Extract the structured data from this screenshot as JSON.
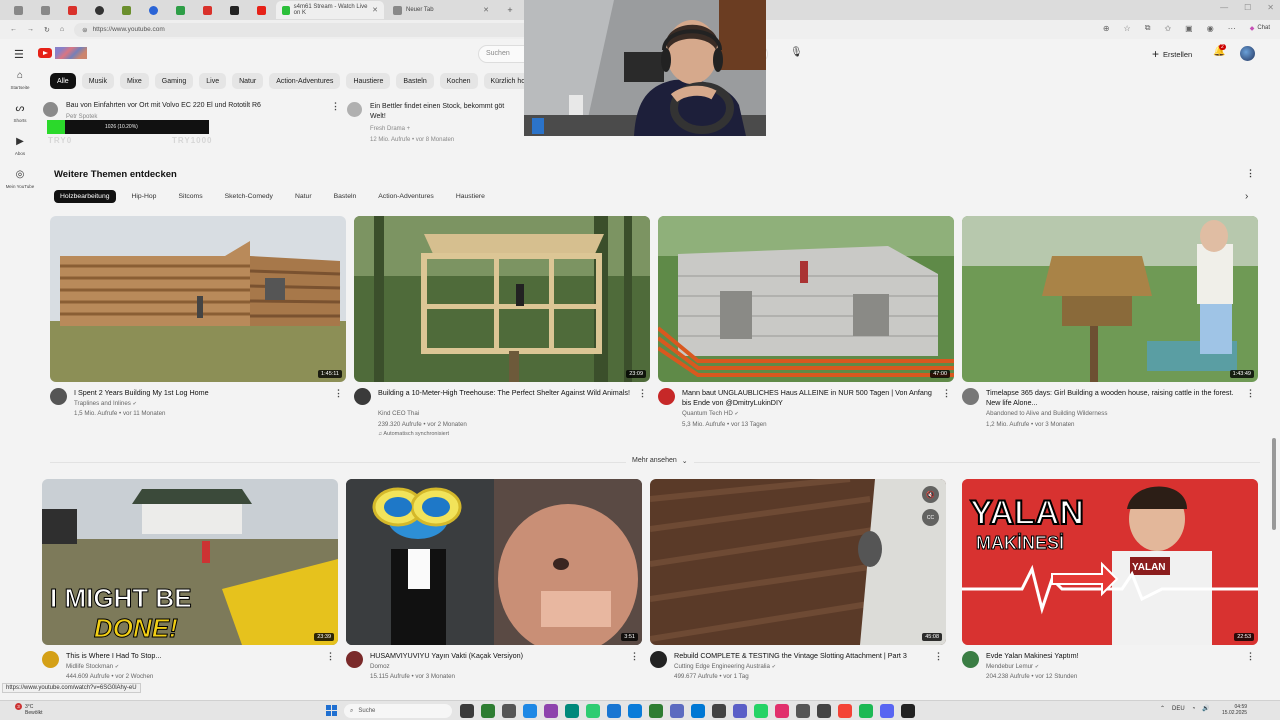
{
  "browser": {
    "tabs": [
      {
        "label": "s4m61 Stream - Watch Live on K",
        "color": "#2bbf3a"
      },
      {
        "label": "Neuer Tab",
        "color": "#888888"
      }
    ],
    "pinned_tab_colors": [
      "#888888",
      "#888888",
      "#d9312b",
      "#333333",
      "#6b8f2d",
      "#2a64d6",
      "#2e9e47",
      "#d9312b",
      "#222222",
      "#e62117"
    ],
    "url": "https://www.youtube.com",
    "chat_label": "Chat"
  },
  "header": {
    "search_placeholder": "Suchen",
    "create_label": "Erstellen",
    "notification_count": "2"
  },
  "sidebar": {
    "items": [
      {
        "label": "Startseite",
        "icon": "home-icon"
      },
      {
        "label": "Shorts",
        "icon": "shorts-icon"
      },
      {
        "label": "Abos",
        "icon": "subscriptions-icon"
      },
      {
        "label": "Mein YouTube",
        "icon": "you-icon"
      }
    ]
  },
  "chips": [
    "Alle",
    "Musik",
    "Mixe",
    "Gaming",
    "Live",
    "Natur",
    "Action-Adventures",
    "Haustiere",
    "Basteln",
    "Kochen",
    "Kürzlich hochgel"
  ],
  "prev_row": {
    "left": {
      "title": "Bau von Einfahrten vor Ort mit Volvo EC 220 El und Rototilt R6",
      "channel": "Petr Spotek",
      "gamebar_text": "1026 (10.20%)",
      "ghost_a": "TRY0",
      "ghost_b": "TRY1000"
    },
    "right": {
      "title_line1": "Ein Bettler findet einen Stock, bekommt göt",
      "title_line2": "Welt!",
      "channel": "Fresh Drama +",
      "meta": "12 Mio. Aufrufe • vor 8 Monaten"
    }
  },
  "topics": {
    "title": "Weitere Themen entdecken",
    "chips": [
      "Holzbearbeitung",
      "Hip-Hop",
      "Sitcoms",
      "Sketch-Comedy",
      "Natur",
      "Basteln",
      "Action-Adventures",
      "Haustiere"
    ]
  },
  "row1": [
    {
      "title": "I Spent 2 Years Building My 1st Log Home",
      "channel": "Traplines and Inlines",
      "meta": "1,5 Mio. Aufrufe • vor 11 Monaten",
      "duration": "1:45:11",
      "avatar": "#555555"
    },
    {
      "title": "Building a 10-Meter-High Treehouse: The Perfect Shelter Against Wild Animals!",
      "channel": "Kind CEO Thai",
      "meta": "239.320 Aufrufe • vor 2 Monaten",
      "duration": "23:09",
      "avatar": "#3a3a3a",
      "extra": "Automatisch synchronisiert"
    },
    {
      "title": "Mann baut UNGLAUBLICHES Haus ALLEINE in NUR 500 Tagen | Von Anfang bis Ende von @DmitryLukinDIY",
      "channel": "Quantum Tech HD",
      "meta": "5,3 Mio. Aufrufe • vor 13 Tagen",
      "duration": "47:00",
      "avatar": "#c62828"
    },
    {
      "title": "Timelapse 365 days: Girl Building a wooden house, raising cattle in the forest.   New life Alone...",
      "channel": "Abandoned to Alive and Building Wilderness",
      "meta": "1,2 Mio. Aufrufe • vor 3 Monaten",
      "duration": "1:43:49",
      "avatar": "#777777"
    }
  ],
  "mehr_label": "Mehr ansehen",
  "row2": [
    {
      "title": "This is Where I Had To Stop...",
      "channel": "Midlife Stockman",
      "meta": "444.609 Aufrufe • vor 2 Wochen",
      "duration": "23:39",
      "avatar": "#d4a017",
      "overlay_a": "I MIGHT BE",
      "overlay_b": "DONE!"
    },
    {
      "title": "HUSAMVIYUVIYU Yayın Vakti (Kaçak Versiyon)",
      "channel": "Domoz",
      "meta": "15.115 Aufrufe • vor 3 Monaten",
      "duration": "3:51",
      "avatar": "#7a2a2a"
    },
    {
      "title": "Rebuild COMPLETE & TESTING the Vintage Slotting Attachment | Part 3",
      "channel": "Cutting Edge Engineering Australia",
      "meta": "499.677 Aufrufe • vor 1 Tag",
      "duration": "45:08",
      "avatar": "#222222",
      "cc": "CC"
    },
    {
      "title": "Evde Yalan Makinesi Yaptım!",
      "channel": "Mendebur Lemur",
      "meta": "204.238 Aufrufe • vor 12 Stunden",
      "duration": "22:53",
      "avatar": "#3a7d44",
      "overlay_a": "YALAN",
      "overlay_b": "MAKİNESİ",
      "overlay_c": "YALAN"
    }
  ],
  "status_url": "https://www.youtube.com/watch?v=6SG0lAhy-eU",
  "taskbar": {
    "weather_temp": "3°C",
    "weather_desc": "Bewölkt",
    "weather_badge": "3",
    "search_label": "Suche",
    "app_colors": [
      "#3a3a3a",
      "#2e7d32",
      "#555555",
      "#1e88e5",
      "#8e44ad",
      "#00897b",
      "#2ecc71",
      "#1976d2",
      "#0a7cd9",
      "#2e7d32",
      "#5c6bc0",
      "#0078d4",
      "#444444",
      "#5b5fc7",
      "#25d366",
      "#e1306c",
      "#555555",
      "#444444",
      "#f44336",
      "#1db954",
      "#5865f2",
      "#222222"
    ],
    "lang": "DEU",
    "time": "04:59",
    "date": "15.02.2025"
  }
}
